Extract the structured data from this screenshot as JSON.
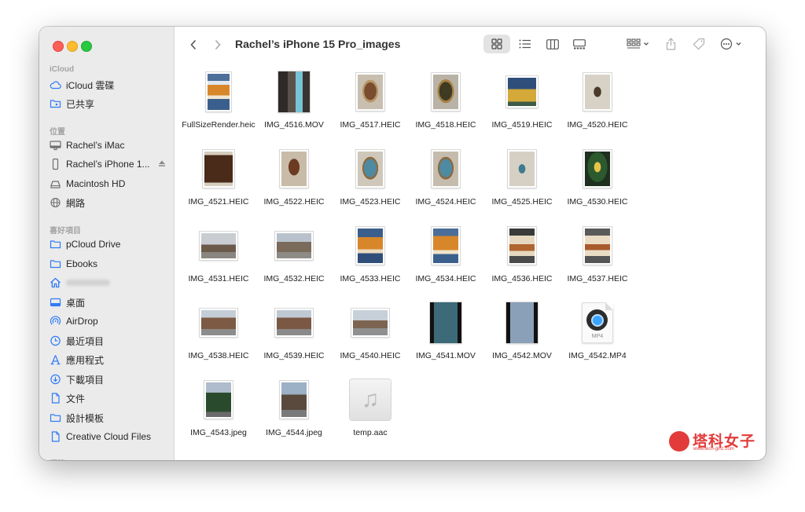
{
  "window": {
    "title": "Rachel’s iPhone 15 Pro_images"
  },
  "sidebar": {
    "sections": [
      {
        "label": "iCloud"
      },
      {
        "label": "位置"
      },
      {
        "label": "喜好項目"
      },
      {
        "label": "標籤"
      }
    ],
    "icloud_items": [
      {
        "label": "iCloud 雲碟",
        "icon": "cloud-icon"
      },
      {
        "label": "已共享",
        "icon": "shared-folder-icon"
      }
    ],
    "location_items": [
      {
        "label": "Rachel’s iMac",
        "icon": "imac-icon"
      },
      {
        "label": "Rachel’s iPhone 1...",
        "icon": "iphone-icon"
      },
      {
        "label": "Macintosh HD",
        "icon": "hard-drive-icon"
      },
      {
        "label": "網路",
        "icon": "network-icon"
      }
    ],
    "favorite_items": [
      {
        "label": "pCloud Drive",
        "icon": "folder-icon"
      },
      {
        "label": "Ebooks",
        "icon": "folder-icon"
      },
      {
        "label": "",
        "icon": "home-icon"
      },
      {
        "label": "桌面",
        "icon": "desktop-icon"
      },
      {
        "label": "AirDrop",
        "icon": "airdrop-icon"
      },
      {
        "label": "最近項目",
        "icon": "clock-icon"
      },
      {
        "label": "應用程式",
        "icon": "applications-icon"
      },
      {
        "label": "下載項目",
        "icon": "download-icon"
      },
      {
        "label": "文件",
        "icon": "document-icon"
      },
      {
        "label": "設計模板",
        "icon": "folder-icon"
      },
      {
        "label": "Creative Cloud Files",
        "icon": "document-icon"
      }
    ]
  },
  "files": [
    {
      "name": "FullSizeRender.heic",
      "kind": "image"
    },
    {
      "name": "IMG_4516.MOV",
      "kind": "video"
    },
    {
      "name": "IMG_4517.HEIC",
      "kind": "image"
    },
    {
      "name": "IMG_4518.HEIC",
      "kind": "image"
    },
    {
      "name": "IMG_4519.HEIC",
      "kind": "image"
    },
    {
      "name": "IMG_4520.HEIC",
      "kind": "image"
    },
    {
      "name": "IMG_4521.HEIC",
      "kind": "image"
    },
    {
      "name": "IMG_4522.HEIC",
      "kind": "image"
    },
    {
      "name": "IMG_4523.HEIC",
      "kind": "image"
    },
    {
      "name": "IMG_4524.HEIC",
      "kind": "image"
    },
    {
      "name": "IMG_4525.HEIC",
      "kind": "image"
    },
    {
      "name": "IMG_4530.HEIC",
      "kind": "image"
    },
    {
      "name": "IMG_4531.HEIC",
      "kind": "image"
    },
    {
      "name": "IMG_4532.HEIC",
      "kind": "image"
    },
    {
      "name": "IMG_4533.HEIC",
      "kind": "image"
    },
    {
      "name": "IMG_4534.HEIC",
      "kind": "image"
    },
    {
      "name": "IMG_4536.HEIC",
      "kind": "image"
    },
    {
      "name": "IMG_4537.HEIC",
      "kind": "image"
    },
    {
      "name": "IMG_4538.HEIC",
      "kind": "image"
    },
    {
      "name": "IMG_4539.HEIC",
      "kind": "image"
    },
    {
      "name": "IMG_4540.HEIC",
      "kind": "image"
    },
    {
      "name": "IMG_4541.MOV",
      "kind": "video"
    },
    {
      "name": "IMG_4542.MOV",
      "kind": "video"
    },
    {
      "name": "IMG_4542.MP4",
      "kind": "mp4",
      "badge": "MP4"
    },
    {
      "name": "IMG_4543.jpeg",
      "kind": "image"
    },
    {
      "name": "IMG_4544.jpeg",
      "kind": "image"
    },
    {
      "name": "temp.aac",
      "kind": "audio"
    }
  ],
  "watermark": {
    "text": "塔科女子",
    "url": "www.tech-girlz.com"
  },
  "colors": {
    "accent": "#2f7bf5",
    "sidebar_bg": "#ebebeb",
    "watermark": "#e33b3b"
  }
}
